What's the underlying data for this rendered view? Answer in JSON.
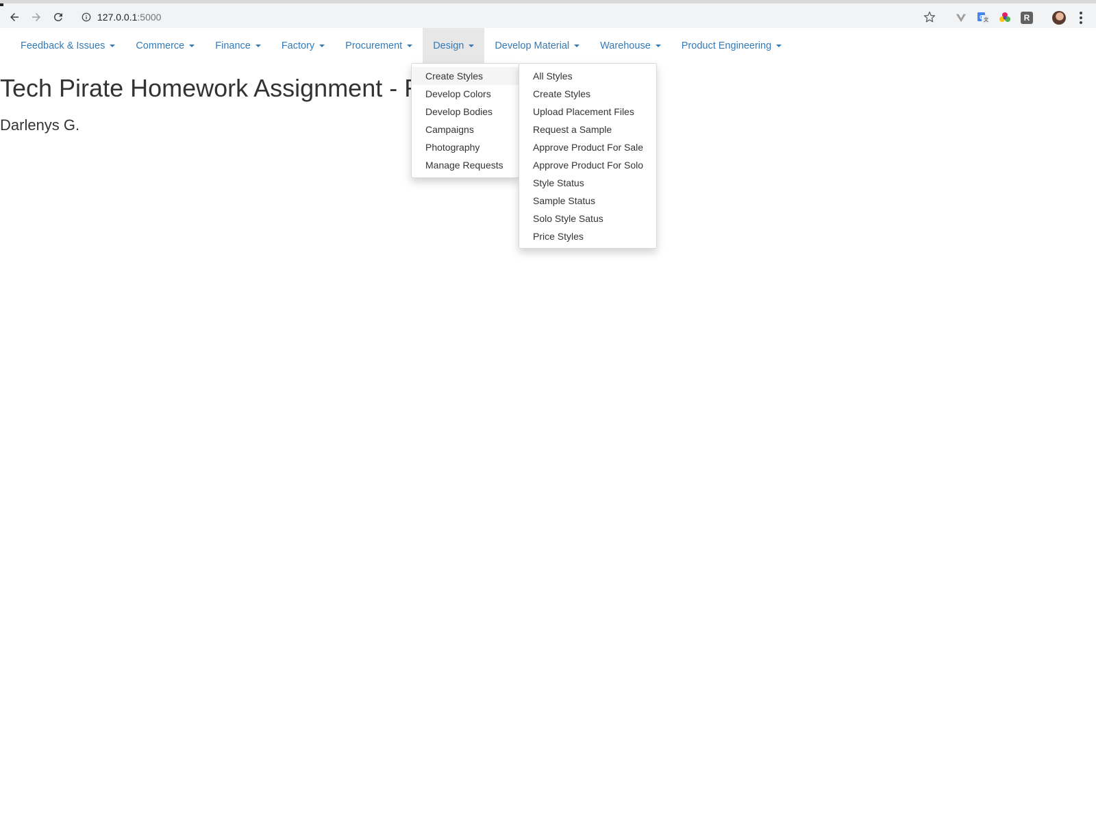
{
  "browser": {
    "url_host": "127.0.0.1",
    "url_port": ":5000",
    "extensions": [
      {
        "icon": "vue-devtools-icon",
        "color": "#9e9e9e"
      },
      {
        "icon": "google-translate-icon",
        "color": "#4285f4"
      },
      {
        "icon": "color-picker-icon",
        "color": "#e91e63"
      },
      {
        "icon": "r-extension-icon",
        "label": "R",
        "color": "#616161"
      }
    ]
  },
  "navbar": {
    "items": [
      {
        "label": "Feedback & Issues"
      },
      {
        "label": "Commerce"
      },
      {
        "label": "Finance"
      },
      {
        "label": "Factory"
      },
      {
        "label": "Procurement"
      },
      {
        "label": "Design"
      },
      {
        "label": "Develop Material"
      },
      {
        "label": "Warehouse"
      },
      {
        "label": "Product Engineering"
      }
    ],
    "link_color": "#337ab7",
    "open_item": "Design"
  },
  "page": {
    "title": "Tech Pirate Homework Assignment - F",
    "subtitle": "Darlenys G."
  },
  "design_menu": {
    "items": [
      "Create Styles",
      "Develop Colors",
      "Develop Bodies",
      "Campaigns",
      "Photography",
      "Manage Requests"
    ],
    "active_item": "Create Styles"
  },
  "styles_submenu": {
    "items": [
      "All Styles",
      "Create Styles",
      "Upload Placement Files",
      "Request a Sample",
      "Approve Product For Sale",
      "Approve Product For Solo",
      "Style Status",
      "Sample Status",
      "Solo Style Satus",
      "Price Styles"
    ]
  }
}
